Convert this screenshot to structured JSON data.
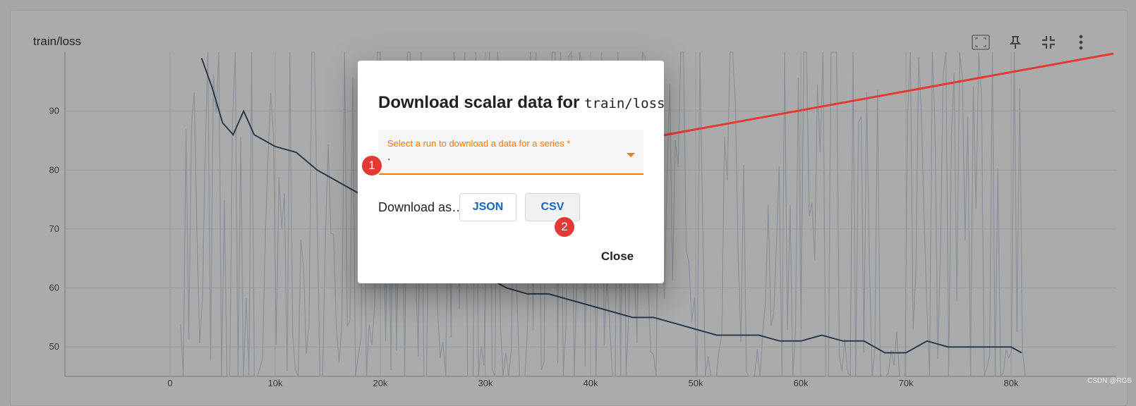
{
  "card": {
    "title": "train/loss",
    "toolbar": [
      {
        "name": "fit-domain-icon"
      },
      {
        "name": "pin-icon"
      },
      {
        "name": "collapse-icon"
      },
      {
        "name": "more-vert-icon"
      }
    ]
  },
  "chart_data": {
    "type": "line",
    "title": "train/loss",
    "xlabel": "",
    "ylabel": "",
    "x_ticks": [
      "0",
      "10k",
      "20k",
      "30k",
      "40k",
      "50k",
      "60k",
      "70k",
      "80k"
    ],
    "y_ticks": [
      "50",
      "60",
      "70",
      "80",
      "90"
    ],
    "xlim": [
      -10000,
      90000
    ],
    "ylim": [
      45,
      100
    ],
    "grid": true,
    "series": [
      {
        "role": "smoothed",
        "color": "#2b3a4e",
        "x": [
          3000,
          4000,
          5000,
          6000,
          7000,
          8000,
          10000,
          12000,
          14000,
          16000,
          18000,
          20000,
          22000,
          24000,
          26000,
          28000,
          30000,
          32000,
          34000,
          36000,
          38000,
          40000,
          42000,
          44000,
          46000,
          48000,
          50000,
          52000,
          54000,
          56000,
          58000,
          60000,
          62000,
          64000,
          66000,
          68000,
          70000,
          72000,
          74000,
          76000,
          78000,
          80000,
          81000
        ],
        "y": [
          99,
          94,
          88,
          86,
          90,
          86,
          84,
          83,
          80,
          78,
          76,
          74,
          72,
          70,
          68,
          66,
          62,
          60,
          59,
          59,
          58,
          57,
          56,
          55,
          55,
          54,
          53,
          52,
          52,
          52,
          51,
          51,
          52,
          51,
          51,
          49,
          49,
          51,
          50,
          50,
          50,
          50,
          49
        ]
      }
    ]
  },
  "dialog": {
    "title_prefix": "Download scalar data for ",
    "title_tag": "train/loss",
    "select": {
      "label": "Select a run to download a data for a series *",
      "value": "."
    },
    "download_as_label": "Download as…",
    "json_label": "JSON",
    "csv_label": "CSV",
    "close_label": "Close"
  },
  "annotations": {
    "marker1": "1",
    "marker2": "2",
    "arrow_color": "#e53935"
  },
  "watermark": "CSDN @RGB"
}
